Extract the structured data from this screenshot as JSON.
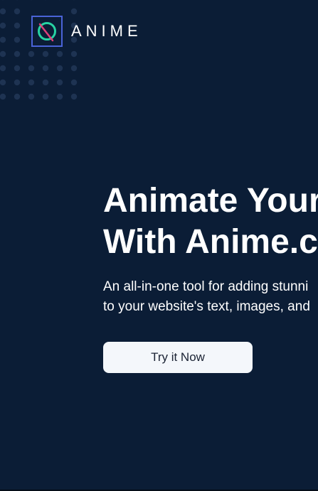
{
  "brand": {
    "name": "ANIME",
    "logo_icon": "anime-logo-icon"
  },
  "hero": {
    "title_line1": "Animate Your",
    "title_line2": "With Anime.cs",
    "subtitle_line1": "An all-in-one tool for adding stunni",
    "subtitle_line2": "to your website's text, images, and",
    "cta_label": "Try it Now"
  },
  "colors": {
    "background": "#0b1d36",
    "dots": "#1e3352",
    "logo_border": "#4a63d8",
    "logo_ring": "#27d3a3",
    "logo_slash": "#e0407a",
    "button_bg": "#f4f7fb",
    "button_text": "#1b2334"
  }
}
